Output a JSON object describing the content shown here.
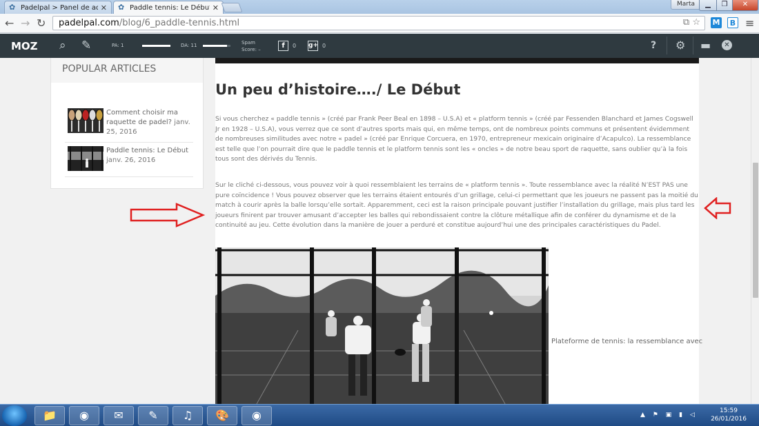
{
  "browser": {
    "tabs": [
      {
        "title": "Padelpal > Panel de admi",
        "active": false
      },
      {
        "title": "Paddle tennis: Le Début",
        "active": true
      }
    ],
    "user": "Marta",
    "url_host": "padelpal.com",
    "url_path": "/blog/6_paddle-tennis.html",
    "ext_m": "M",
    "ext_b": "B"
  },
  "mozbar": {
    "logo": "MOZ",
    "pa_label": "PA: 1",
    "pa_value": 1,
    "da_label": "DA: 11",
    "da_value": 11,
    "spam_label_1": "Spam",
    "spam_label_2": "Score:",
    "spam_value": "–",
    "facebook_label": "f",
    "facebook_count": "0",
    "gplus_label": "g+",
    "gplus_count": "0",
    "help": "?"
  },
  "sidebar": {
    "title": "POPULAR ARTICLES",
    "articles": [
      {
        "title": "Comment choisir ma raquette de padel?",
        "date": "janv. 25, 2016"
      },
      {
        "title": "Paddle tennis: Le Début",
        "date": "janv. 26, 2016"
      }
    ]
  },
  "article": {
    "heading": "Un peu d’histoire…./ Le Début",
    "paragraph_1": "Si vous cherchez « paddle tennis » (créé par Frank Peer Beal en 1898 – U.S.A) et « platform tennis » (créé par Fessenden Blanchard et James Cogswell Jr en 1928 – U.S.A), vous verrez que ce sont d’autres sports mais qui, en même temps, ont de nombreux points communs et présentent évidemment de nombreuses similitudes avec notre « padel » (créé par Enrique Corcuera, en 1970, entrepreneur mexicain originaire d’Acapulco). La ressemblance est telle que l’on pourrait dire que le paddle tennis et le platform tennis sont les « oncles » de notre beau sport de raquette, sans oublier qu’à la fois tous sont des dérivés du Tennis.",
    "paragraph_2": "Sur le cliché ci-dessous, vous pouvez voir à quoi ressemblaient les terrains de « platform tennis ». Toute ressemblance avec la réalité N’EST PAS une pure coïncidence ! Vous pouvez observer que les terrains étaient entourés d’un grillage, celui-ci permettant que les joueurs ne passent pas la moitié du match à courir après la balle lorsqu’elle sortait. Apparemment, ceci est la raison principale pouvant justifier l’installation du grillage, mais plus tard les joueurs finirent par trouver amusant d’accepter les balles qui rebondissaient contre la clôture métallique afin de conférer du dynamisme et de la continuité au jeu. Cette évolution dans la manière de jouer a perduré et constitue aujourd’hui une des principales caractéristiques du Padel.",
    "photo_caption": "Plateforme de tennis: la ressemblance avec"
  },
  "taskbar": {
    "time": "15:59",
    "date": "26/01/2016"
  },
  "colors": {
    "arrow_red": "#e02020",
    "mozbar_bg": "#2f3a40",
    "taskbar_blue": "#1f4b85"
  }
}
